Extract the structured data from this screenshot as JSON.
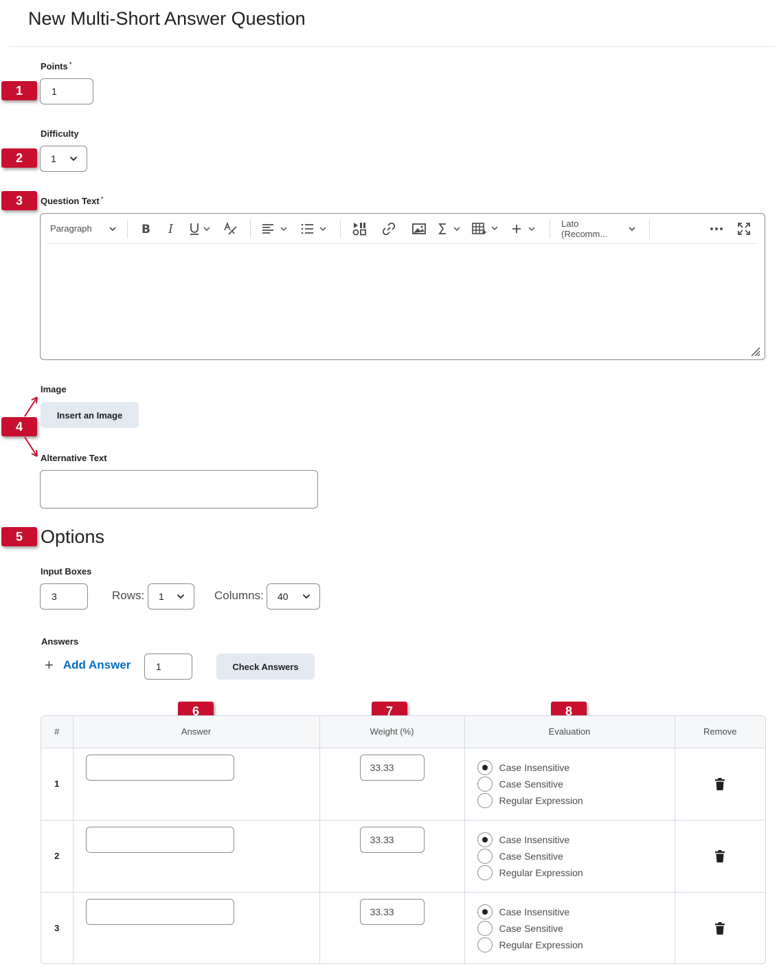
{
  "page": {
    "title": "New Multi-Short Answer Question"
  },
  "points": {
    "label": "Points",
    "required": "*",
    "value": "1"
  },
  "difficulty": {
    "label": "Difficulty",
    "value": "1"
  },
  "question_text": {
    "label": "Question Text",
    "required": "*",
    "toolbar": {
      "format": "Paragraph",
      "font": "Lato (Recomm..."
    }
  },
  "image": {
    "label": "Image",
    "button": "Insert an Image"
  },
  "alt_text": {
    "label": "Alternative Text",
    "value": ""
  },
  "options": {
    "heading": "Options",
    "input_boxes_label": "Input Boxes",
    "input_boxes_value": "3",
    "rows_label": "Rows:",
    "rows_value": "1",
    "columns_label": "Columns:",
    "columns_value": "40"
  },
  "answers": {
    "label": "Answers",
    "add_icon": "+",
    "add_label": "Add Answer",
    "add_count": "1",
    "check_button": "Check Answers"
  },
  "table": {
    "headers": {
      "num": "#",
      "answer": "Answer",
      "weight": "Weight (%)",
      "evaluation": "Evaluation",
      "remove": "Remove"
    },
    "rows": [
      {
        "num": "1",
        "answer": "",
        "weight": "33.33"
      },
      {
        "num": "2",
        "answer": "",
        "weight": "33.33"
      },
      {
        "num": "3",
        "answer": "",
        "weight": "33.33"
      }
    ],
    "eval_options": [
      "Case Insensitive",
      "Case Sensitive",
      "Regular Expression"
    ],
    "selected_eval": "Case Insensitive"
  },
  "annotations": [
    "1",
    "2",
    "3",
    "4",
    "5",
    "6",
    "7",
    "8"
  ],
  "colors": {
    "badge": "#c8102e",
    "link": "#006fbf",
    "button_bg": "#e3e9f1",
    "border": "#868c8f"
  }
}
